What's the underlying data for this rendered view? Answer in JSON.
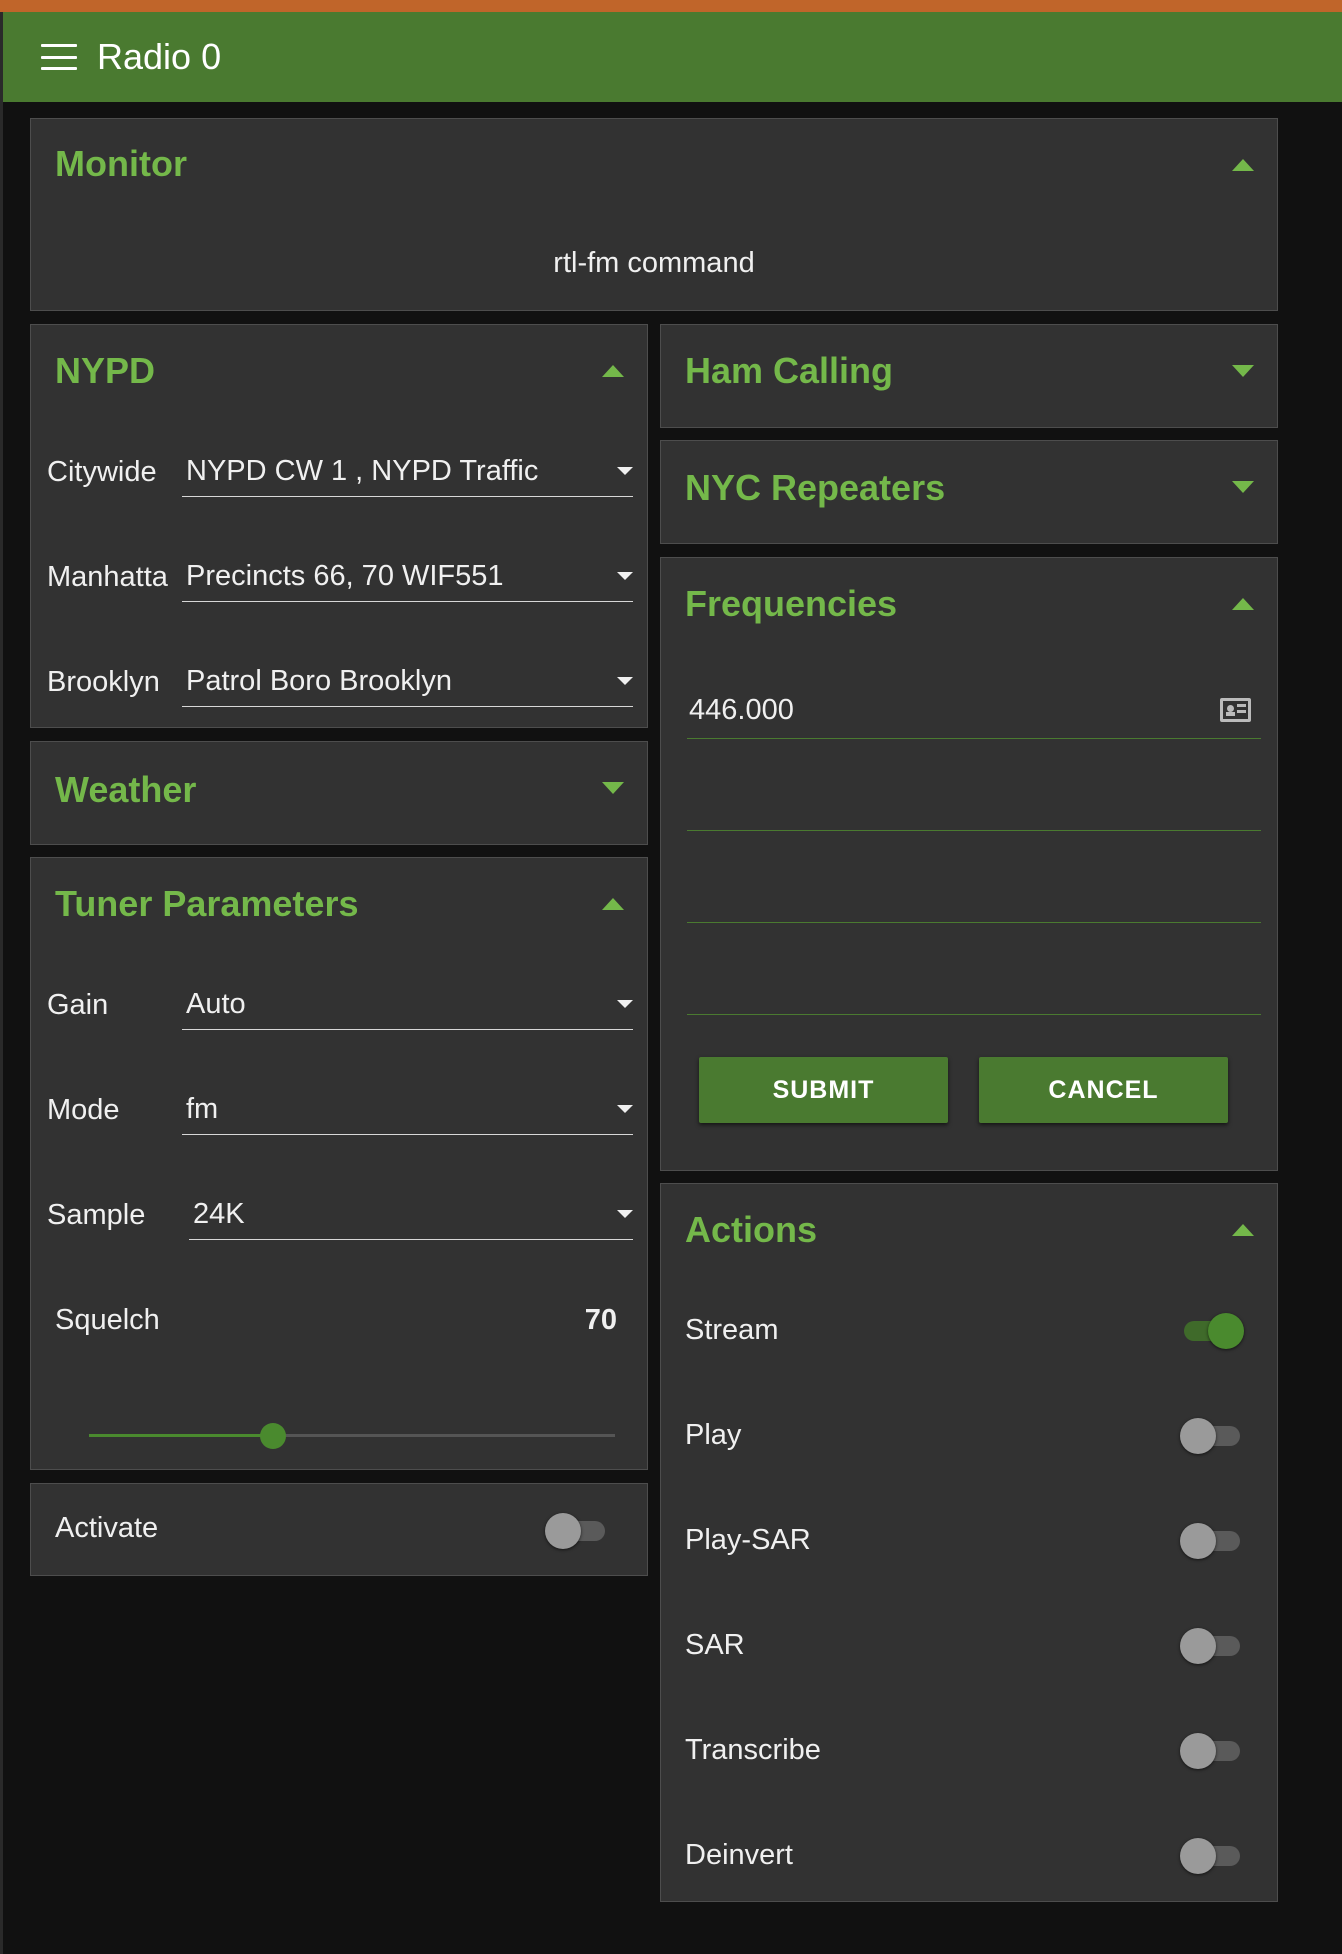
{
  "app": {
    "title": "Radio 0"
  },
  "monitor": {
    "title": "Monitor",
    "command_label": "rtl-fm command"
  },
  "nypd": {
    "title": "NYPD",
    "fields": [
      {
        "label": "Citywide",
        "value": "NYPD CW 1 , NYPD Traffic"
      },
      {
        "label": "Manhattan",
        "value": "Precincts 66, 70 WIF551"
      },
      {
        "label": "Brooklyn",
        "value": "Patrol Boro Brooklyn"
      }
    ]
  },
  "weather": {
    "title": "Weather"
  },
  "tuner": {
    "title": "Tuner Parameters",
    "fields": [
      {
        "label": "Gain",
        "value": "Auto"
      },
      {
        "label": "Mode",
        "value": "fm"
      },
      {
        "label": "Sample",
        "value": "24K"
      }
    ],
    "squelch": {
      "label": "Squelch",
      "value": "70",
      "min": 0,
      "max": 200
    }
  },
  "activate": {
    "label": "Activate",
    "on": false
  },
  "ham_calling": {
    "title": "Ham Calling"
  },
  "nyc_repeaters": {
    "title": "NYC Repeaters"
  },
  "frequencies": {
    "title": "Frequencies",
    "values": [
      "446.000",
      "",
      "",
      ""
    ],
    "submit_label": "SUBMIT",
    "cancel_label": "CANCEL"
  },
  "actions": {
    "title": "Actions",
    "items": [
      {
        "label": "Stream",
        "on": true
      },
      {
        "label": "Play",
        "on": false
      },
      {
        "label": "Play-SAR",
        "on": false
      },
      {
        "label": "SAR",
        "on": false
      },
      {
        "label": "Transcribe",
        "on": false
      },
      {
        "label": "Deinvert",
        "on": false
      }
    ]
  },
  "colors": {
    "accent": "#74b84a",
    "appbar": "#4a7a30",
    "panel": "#323232",
    "background": "#111111"
  }
}
